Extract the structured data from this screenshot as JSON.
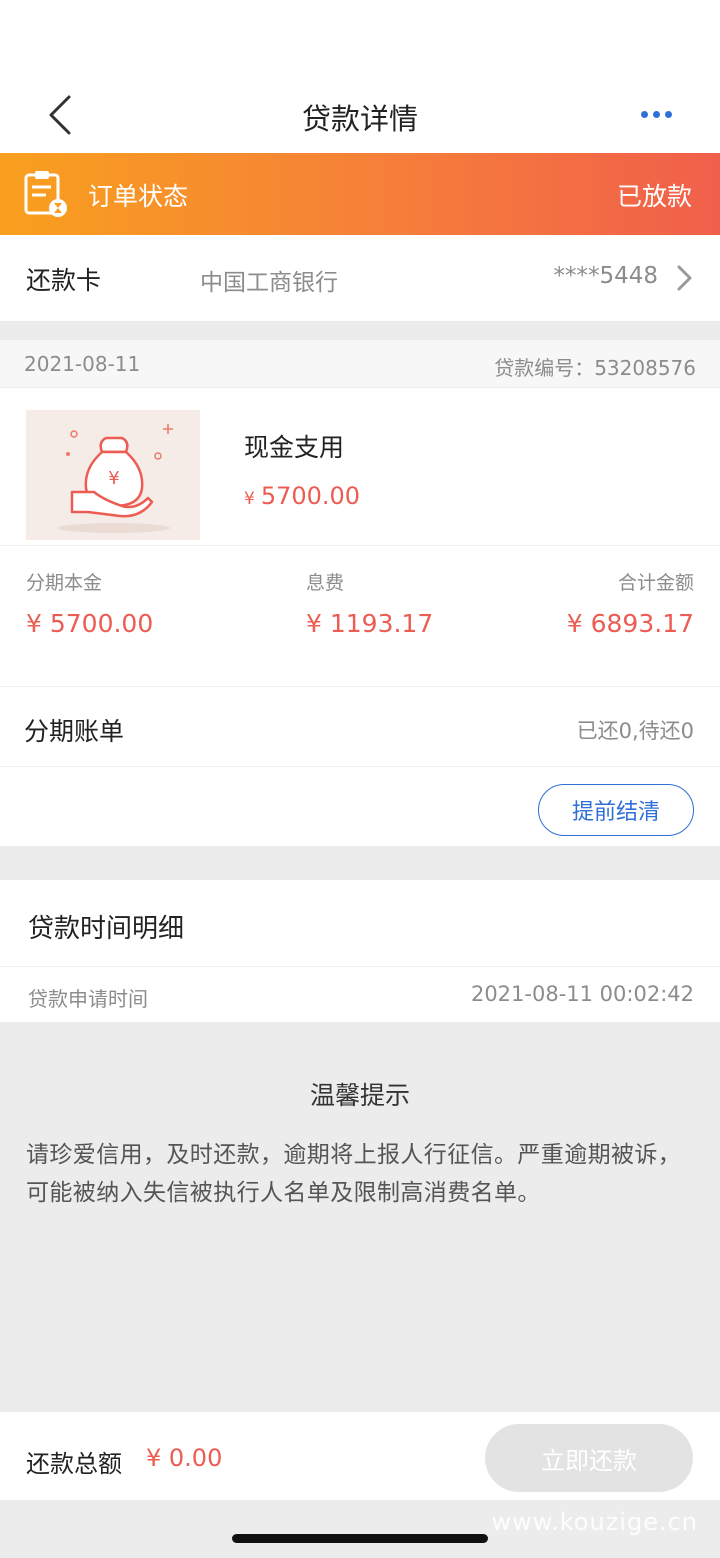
{
  "header": {
    "title": "贷款详情"
  },
  "order_status": {
    "label": "订单状态",
    "value": "已放款"
  },
  "repay_card": {
    "label": "还款卡",
    "bank": "中国工商银行",
    "number": "****5448"
  },
  "loan": {
    "date": "2021-08-11",
    "loan_no": "贷款编号：53208576",
    "product_name": "现金支用",
    "product_amount_symbol": "¥",
    "product_amount": "5700.00",
    "principal_label": "分期本金",
    "principal": "¥ 5700.00",
    "fee_label": "息费",
    "fee": "¥ 1193.17",
    "total_label": "合计金额",
    "total": "¥ 6893.17",
    "bill_title": "分期账单",
    "bill_status": "已还0,待还0",
    "settle_label": "提前结清"
  },
  "time_detail": {
    "title": "贷款时间明细",
    "apply_label": "贷款申请时间",
    "apply_time": "2021-08-11 00:02:42"
  },
  "tip": {
    "title": "温馨提示",
    "text": "请珍爱信用，及时还款，逾期将上报人行征信。严重逾期被诉，可能被纳入失信被执行人名单及限制高消费名单。"
  },
  "footer": {
    "total_label": "还款总额",
    "total_amount": "¥ 0.00",
    "pay_label": "立即还款"
  },
  "watermark": "www.kouzige.cn",
  "colors": {
    "accent_blue": "#2f6fd8",
    "amount_red": "#ec5c52",
    "status_orange": "#f8a01e",
    "status_red": "#f05f4b"
  }
}
